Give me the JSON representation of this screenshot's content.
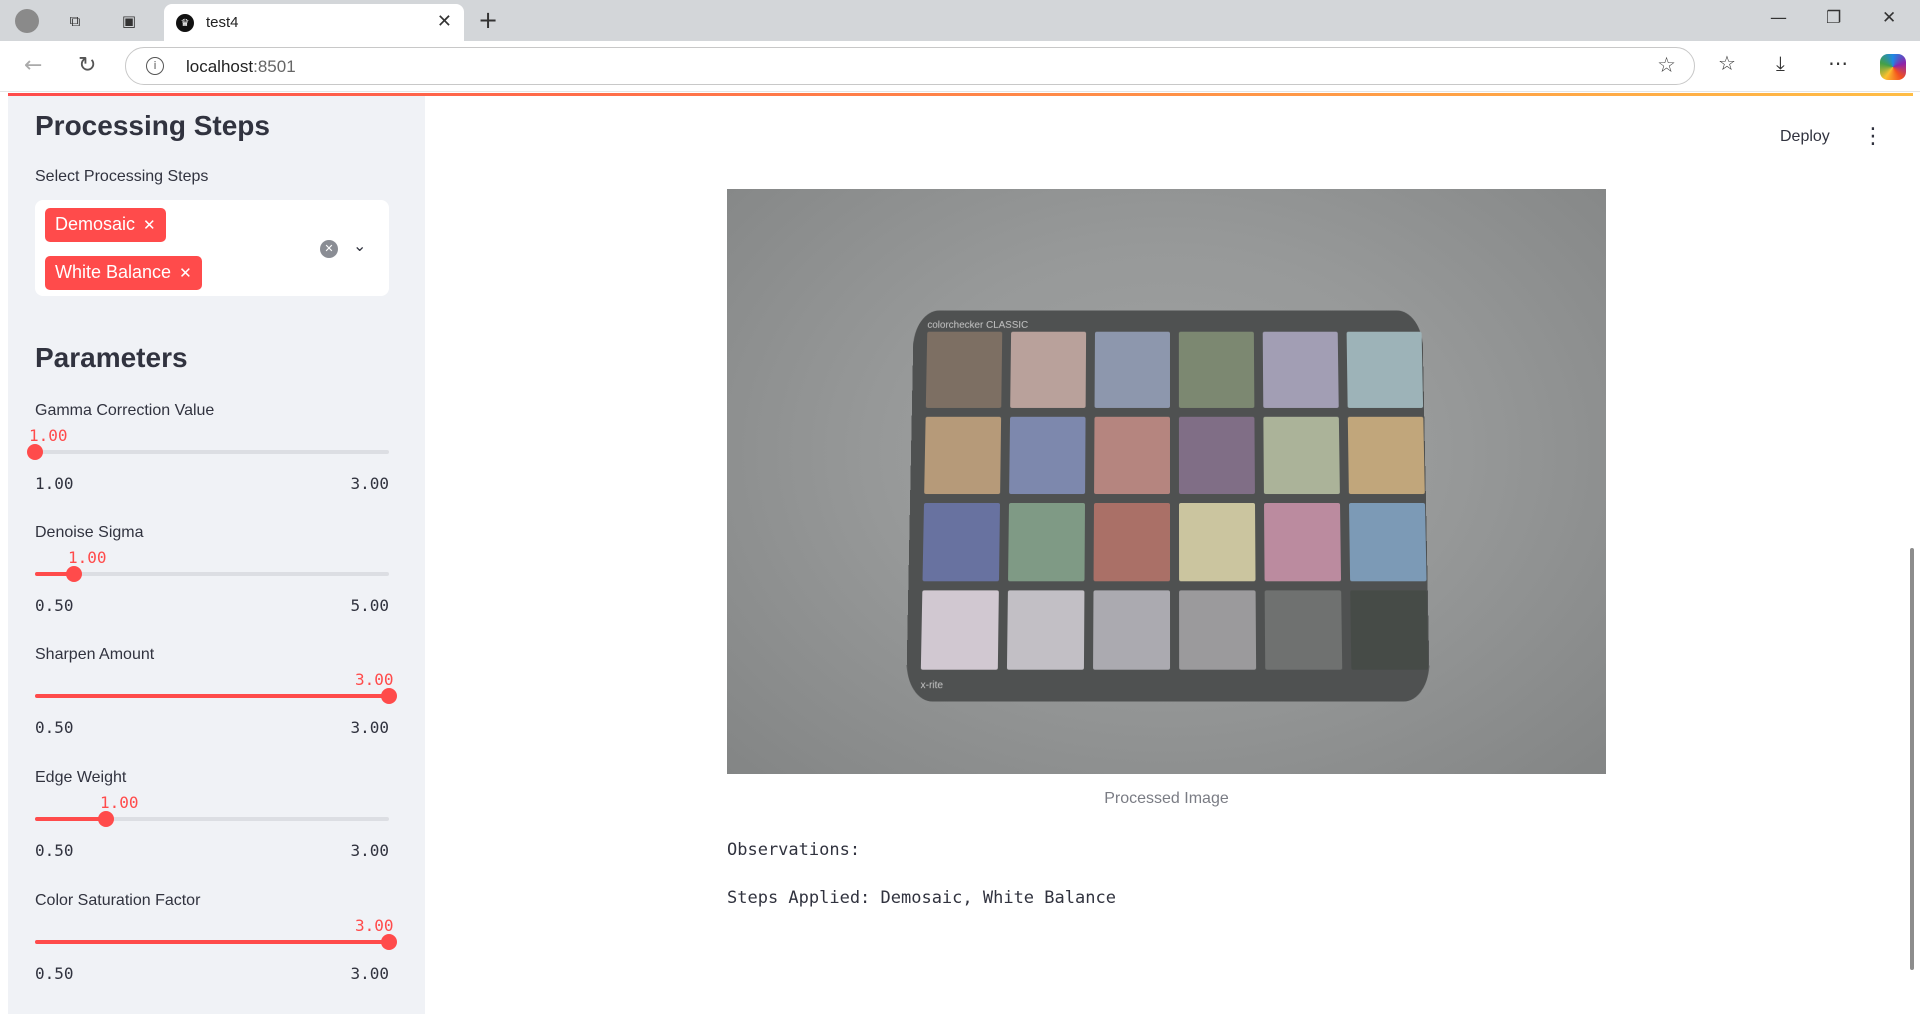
{
  "browser": {
    "tab_title": "test4",
    "url_host": "localhost",
    "url_port": ":8501"
  },
  "sidebar": {
    "processing_heading": "Processing Steps",
    "select_label": "Select Processing Steps",
    "selected_steps": [
      "Demosaic",
      "White Balance"
    ],
    "parameters_heading": "Parameters",
    "sliders": [
      {
        "label": "Gamma Correction Value",
        "value": "1.00",
        "min": "1.00",
        "max": "3.00",
        "fraction": 0.0
      },
      {
        "label": "Denoise Sigma",
        "value": "1.00",
        "min": "0.50",
        "max": "5.00",
        "fraction": 0.111
      },
      {
        "label": "Sharpen Amount",
        "value": "3.00",
        "min": "0.50",
        "max": "3.00",
        "fraction": 1.0
      },
      {
        "label": "Edge Weight",
        "value": "1.00",
        "min": "0.50",
        "max": "3.00",
        "fraction": 0.2
      },
      {
        "label": "Color Saturation Factor",
        "value": "3.00",
        "min": "0.50",
        "max": "3.00",
        "fraction": 1.0
      }
    ]
  },
  "main": {
    "deploy_label": "Deploy",
    "image_caption": "Processed Image",
    "observations_label": "Observations:",
    "steps_applied": "Steps Applied: Demosaic, White Balance",
    "checker_brand": "colorchecker CLASSIC",
    "checker_maker": "x-rite",
    "patch_colors": [
      "#7d6f63",
      "#b9a19b",
      "#8d97ad",
      "#7c8871",
      "#a29eb4",
      "#9db3b8",
      "#b69a79",
      "#7d88ad",
      "#b5857f",
      "#806e86",
      "#abb399",
      "#c1a67b",
      "#6872a0",
      "#7f9a85",
      "#aa7067",
      "#cbc59f",
      "#bb8b9f",
      "#7c9ab6",
      "#d1c8d1",
      "#c2bfc5",
      "#abaab0",
      "#9b9a9c",
      "#6f7170",
      "#464b47"
    ]
  }
}
